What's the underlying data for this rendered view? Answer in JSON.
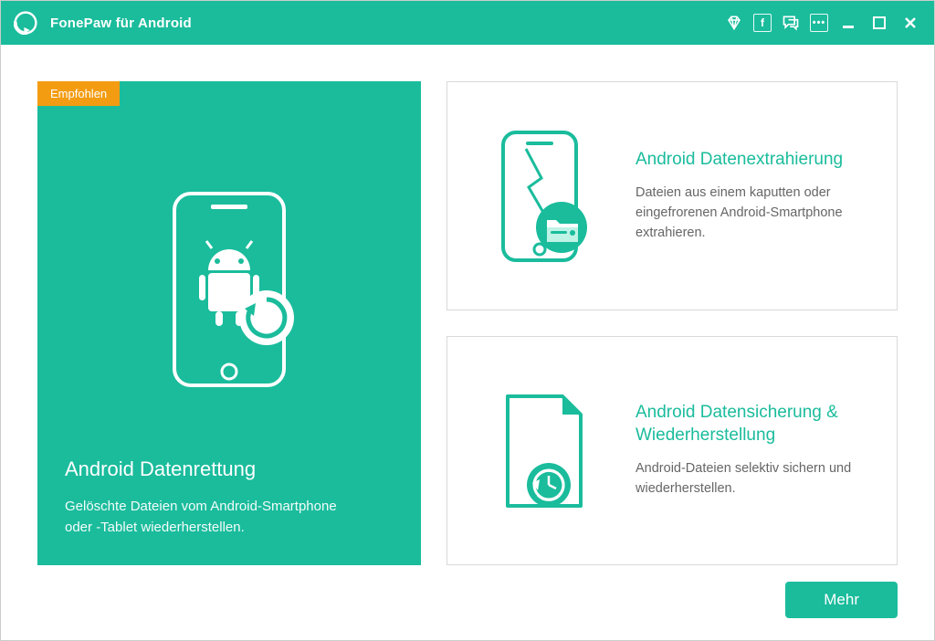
{
  "app": {
    "title": "FonePaw für Android"
  },
  "colors": {
    "accent": "#1abc9c",
    "badge": "#f39c12"
  },
  "cards": {
    "primary": {
      "badge": "Empfohlen",
      "title": "Android Datenrettung",
      "desc": "Gelöschte Dateien vom Android-Smartphone oder -Tablet wiederherstellen."
    },
    "extract": {
      "title": "Android Datenextrahierung",
      "desc": "Dateien aus einem kaputten oder eingefrorenen Android-Smartphone extrahieren."
    },
    "backup": {
      "title": "Android Datensicherung & Wiederherstellung",
      "desc": "Android-Dateien selektiv sichern und wiederherstellen."
    }
  },
  "buttons": {
    "more": "Mehr"
  }
}
